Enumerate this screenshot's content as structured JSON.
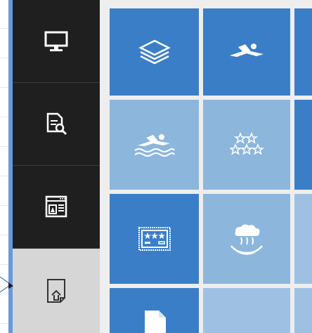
{
  "sidebar": {
    "items": [
      {
        "id": "display",
        "icon": "monitor-icon",
        "active": false
      },
      {
        "id": "document-search",
        "icon": "document-search-icon",
        "active": false
      },
      {
        "id": "web-page",
        "icon": "web-page-icon",
        "active": false
      },
      {
        "id": "upload",
        "icon": "file-upload-icon",
        "active": true
      }
    ]
  },
  "grid": {
    "tiles": [
      {
        "icon": "layers-icon",
        "shade": "dark"
      },
      {
        "icon": "swimmer-icon",
        "shade": "dark"
      },
      {
        "icon": "partial-tile",
        "shade": "dark"
      },
      {
        "icon": "swimming-pool-icon",
        "shade": "light"
      },
      {
        "icon": "six-stars-icon",
        "shade": "light"
      },
      {
        "icon": "partial-tile",
        "shade": "dark"
      },
      {
        "icon": "rating-card-icon",
        "shade": "dark"
      },
      {
        "icon": "hot-spring-icon",
        "shade": "light"
      },
      {
        "icon": "partial-tile",
        "shade": "pale"
      },
      {
        "icon": "file-icon",
        "shade": "dark"
      },
      {
        "icon": "partial-tile",
        "shade": "pale"
      },
      {
        "icon": "partial-tile",
        "shade": "pale"
      }
    ]
  },
  "colors": {
    "sidebar_bg": "#1f1f1f",
    "sidebar_active": "#d6d6d6",
    "tile_dark": "#3b7ec8",
    "tile_light": "#8db6dc",
    "accent": "#6a98d9"
  }
}
